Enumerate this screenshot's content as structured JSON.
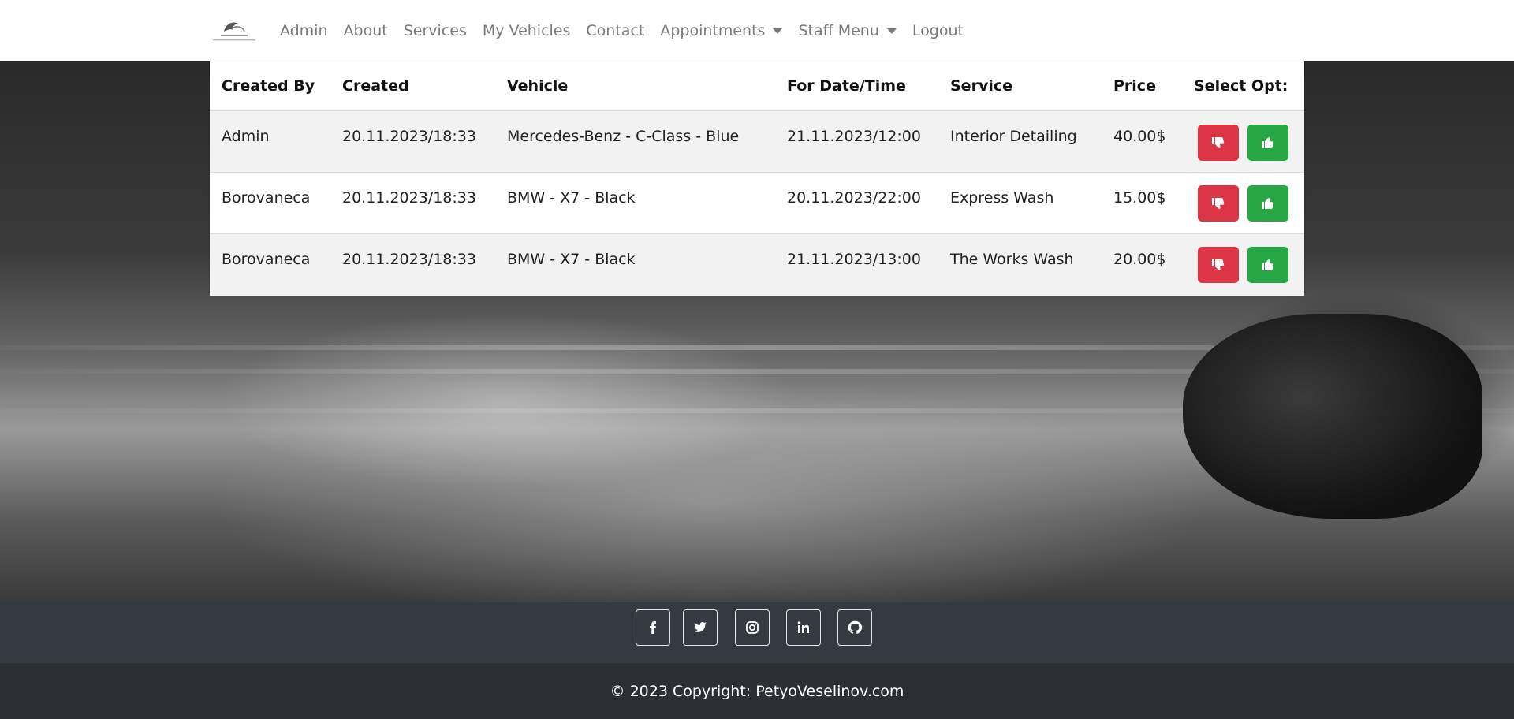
{
  "nav": {
    "logo_icon": "car-wash-logo",
    "links": [
      {
        "label": "Admin"
      },
      {
        "label": "About"
      },
      {
        "label": "Services"
      },
      {
        "label": "My Vehicles"
      },
      {
        "label": "Contact"
      },
      {
        "label": "Appointments",
        "dropdown": true
      },
      {
        "label": "Staff Menu",
        "dropdown": true
      },
      {
        "label": "Logout"
      }
    ]
  },
  "table": {
    "headers": [
      "Created By",
      "Created",
      "Vehicle",
      "For Date/Time",
      "Service",
      "Price",
      "Select Opt:"
    ],
    "rows": [
      {
        "created_by": "Admin",
        "created": "20.11.2023/18:33",
        "vehicle": "Mercedes-Benz - C-Class - Blue",
        "for_datetime": "21.11.2023/12:00",
        "service": "Interior Detailing",
        "price": "40.00$"
      },
      {
        "created_by": "Borovaneca",
        "created": "20.11.2023/18:33",
        "vehicle": "BMW - X7 - Black",
        "for_datetime": "20.11.2023/22:00",
        "service": "Express Wash",
        "price": "15.00$"
      },
      {
        "created_by": "Borovaneca",
        "created": "20.11.2023/18:33",
        "vehicle": "BMW - X7 - Black",
        "for_datetime": "21.11.2023/13:00",
        "service": "The Works Wash",
        "price": "20.00$"
      }
    ],
    "actions": {
      "reject_icon": "thumbs-down-icon",
      "approve_icon": "thumbs-up-icon"
    }
  },
  "footer": {
    "social": [
      "facebook-icon",
      "twitter-icon",
      "instagram-icon",
      "linkedin-icon",
      "github-icon"
    ],
    "copyright": "© 2023 Copyright: PetyoVeselinov.com"
  },
  "colors": {
    "reject": "#dc3545",
    "approve": "#28a745",
    "footer_top": "#343a40",
    "footer_bottom": "#2c3035"
  }
}
